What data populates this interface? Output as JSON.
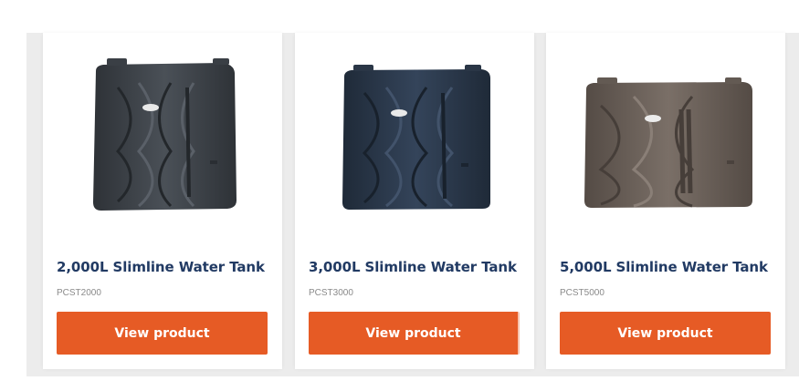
{
  "products": [
    {
      "title": "2,000L Slimline Water Tank",
      "sku": "PCST2000",
      "button_label": "View product",
      "tank_color": "#44494f",
      "icon": "water-tank-image"
    },
    {
      "title": "3,000L Slimline Water Tank",
      "sku": "PCST3000",
      "button_label": "View product",
      "tank_color": "#2c3a4c",
      "icon": "water-tank-image"
    },
    {
      "title": "5,000L Slimline Water Tank",
      "sku": "PCST5000",
      "button_label": "View product",
      "tank_color": "#6b615a",
      "icon": "water-tank-image"
    }
  ],
  "colors": {
    "title": "#213a63",
    "button": "#e65b25",
    "sku": "#8a8a8a"
  }
}
